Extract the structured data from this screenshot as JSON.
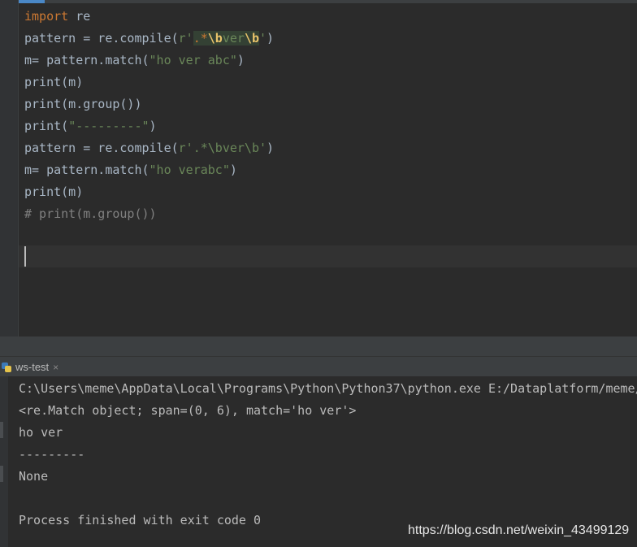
{
  "editor": {
    "lines": [
      {
        "kw": "import",
        "rest": " re"
      },
      {
        "a": "pattern = re.compile(",
        "b": "r'",
        "c": ".*",
        "d": "\\b",
        "e": "ver",
        "f": "\\b",
        "g": "'",
        "h": ")"
      },
      {
        "a": "m= pattern.match(",
        "b": "\"ho ver abc\"",
        "c": ")"
      },
      {
        "a": "print(m)"
      },
      {
        "a": "print(m.group())"
      },
      {
        "a": "print(",
        "b": "\"---------\"",
        "c": ")"
      },
      {
        "a": "pattern = re.compile(",
        "b": "r'.*\\bver\\b'",
        "c": ")"
      },
      {
        "a": "m= pattern.match(",
        "b": "\"ho verabc\"",
        "c": ")"
      },
      {
        "a": "print(m)"
      },
      {
        "cmt": "# print(m.group())"
      }
    ]
  },
  "run_panel": {
    "tab_label": "ws-test",
    "close_glyph": "×"
  },
  "console": {
    "lines": [
      "C:\\Users\\meme\\AppData\\Local\\Programs\\Python\\Python37\\python.exe E:/Dataplatform/meme/",
      "<re.Match object; span=(0, 6), match='ho ver'>",
      "ho ver",
      "---------",
      "None",
      "",
      "Process finished with exit code 0"
    ]
  },
  "watermark": "https://blog.csdn.net/weixin_43499129",
  "colors": {
    "background": "#2b2b2b",
    "keyword": "#cc7832",
    "string": "#6a8759",
    "comment": "#808080",
    "text": "#a9b7c6"
  }
}
